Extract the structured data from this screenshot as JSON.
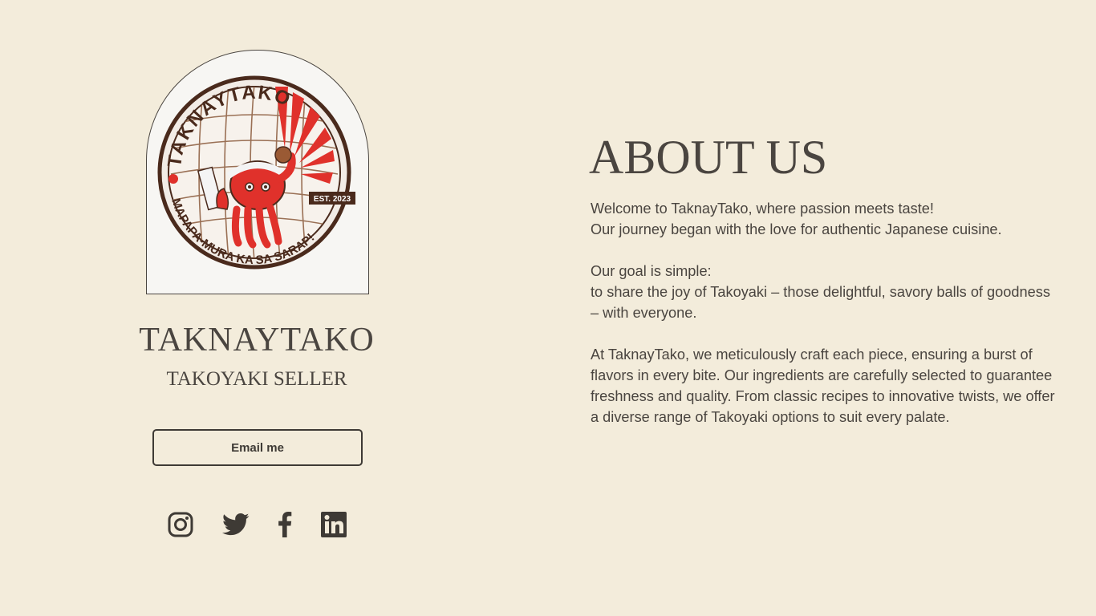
{
  "profile": {
    "logo": {
      "name": "TAKNAYTAKO",
      "tagline": "MAPAPA-MURA KA SA SARAP!",
      "badge": "EST. 2023"
    },
    "title": "TAKNAYTAKO",
    "subtitle": "TAKOYAKI SELLER",
    "email_button_label": "Email me",
    "socials": [
      {
        "name": "instagram",
        "icon": "instagram-icon"
      },
      {
        "name": "twitter",
        "icon": "twitter-icon"
      },
      {
        "name": "facebook",
        "icon": "facebook-icon"
      },
      {
        "name": "linkedin",
        "icon": "linkedin-icon"
      }
    ]
  },
  "about": {
    "heading": "ABOUT US",
    "paragraphs": [
      [
        "Welcome to TaknayTako, where passion meets taste!",
        "Our journey began with the love for authentic Japanese cuisine."
      ],
      [
        "Our goal is simple:",
        "to share the joy of Takoyaki – those delightful, savory balls of goodness – with everyone."
      ],
      [
        "At TaknayTako, we meticulously craft each piece, ensuring a burst of flavors in every bite. Our ingredients are carefully selected to guarantee freshness and quality. From classic recipes to innovative twists, we offer a diverse range of Takoyaki options to suit every palate."
      ]
    ]
  },
  "colors": {
    "background": "#f3ecdb",
    "text": "#4a4540",
    "logo_red": "#e0312b",
    "logo_brown": "#4a2a1c"
  }
}
